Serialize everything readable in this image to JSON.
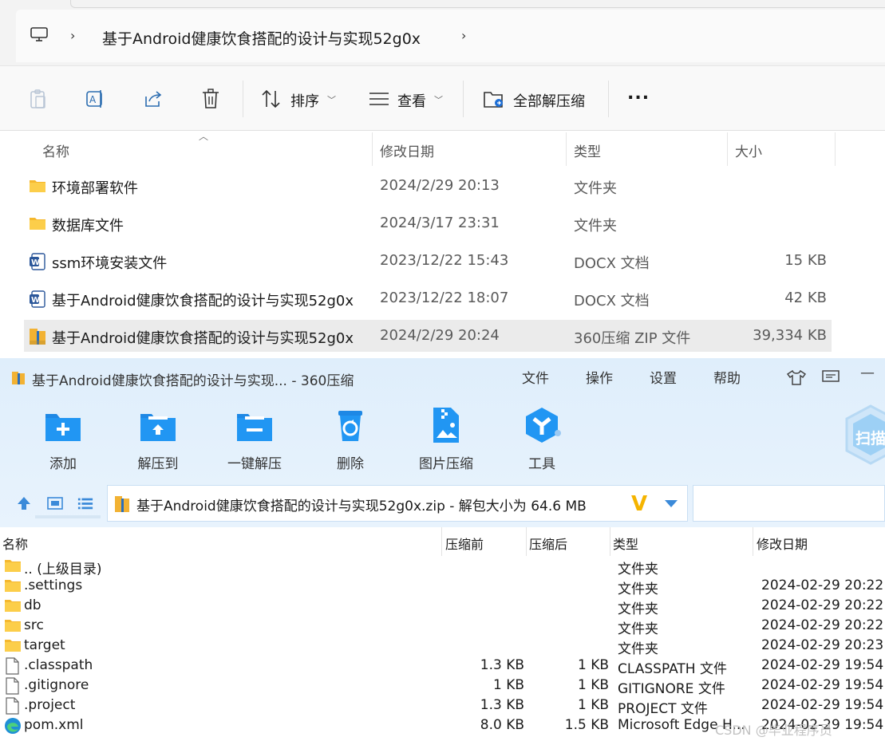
{
  "explorer": {
    "breadcrumb": "基于Android健康饮食搭配的设计与实现52g0x",
    "toolbar": {
      "sort_label": "排序",
      "view_label": "查看",
      "extract_all_label": "全部解压缩",
      "more_label": "..."
    },
    "columns": {
      "name": "名称",
      "date": "修改日期",
      "type": "类型",
      "size": "大小"
    },
    "files": [
      {
        "name": "环境部署软件",
        "date": "2024/2/29 20:13",
        "type": "文件夹",
        "size": "",
        "icon": "folder"
      },
      {
        "name": "数据库文件",
        "date": "2024/3/17 23:31",
        "type": "文件夹",
        "size": "",
        "icon": "folder"
      },
      {
        "name": "ssm环境安装文件",
        "date": "2023/12/22 15:43",
        "type": "DOCX 文档",
        "size": "15 KB",
        "icon": "word"
      },
      {
        "name": "基于Android健康饮食搭配的设计与实现52g0x",
        "date": "2023/12/22 18:07",
        "type": "DOCX 文档",
        "size": "42 KB",
        "icon": "word"
      },
      {
        "name": "基于Android健康饮食搭配的设计与实现52g0x",
        "date": "2024/2/29 20:24",
        "type": "360压缩 ZIP 文件",
        "size": "39,334 KB",
        "icon": "zip",
        "selected": true
      }
    ]
  },
  "zipapp": {
    "title": "基于Android健康饮食搭配的设计与实现... - 360压缩",
    "menu": [
      "文件",
      "操作",
      "设置",
      "帮助"
    ],
    "toolbar": [
      "添加",
      "解压到",
      "一键解压",
      "删除",
      "图片压缩",
      "工具"
    ],
    "scan_badge": "扫描",
    "path": "基于Android健康饮食搭配的设计与实现52g0x.zip - 解包大小为 64.6 MB",
    "columns": {
      "name": "名称",
      "before": "压缩前",
      "after": "压缩后",
      "type": "类型",
      "date": "修改日期"
    },
    "rows": [
      {
        "name": ".. (上级目录)",
        "before": "",
        "after": "",
        "type": "文件夹",
        "date": "",
        "icon": "folder"
      },
      {
        "name": ".settings",
        "before": "",
        "after": "",
        "type": "文件夹",
        "date": "2024-02-29 20:22",
        "icon": "folder"
      },
      {
        "name": "db",
        "before": "",
        "after": "",
        "type": "文件夹",
        "date": "2024-02-29 20:22",
        "icon": "folder"
      },
      {
        "name": "src",
        "before": "",
        "after": "",
        "type": "文件夹",
        "date": "2024-02-29 20:22",
        "icon": "folder"
      },
      {
        "name": "target",
        "before": "",
        "after": "",
        "type": "文件夹",
        "date": "2024-02-29 20:23",
        "icon": "folder"
      },
      {
        "name": ".classpath",
        "before": "1.3 KB",
        "after": "1 KB",
        "type": "CLASSPATH 文件",
        "date": "2024-02-29 19:54",
        "icon": "file"
      },
      {
        "name": ".gitignore",
        "before": "1 KB",
        "after": "1 KB",
        "type": "GITIGNORE 文件",
        "date": "2024-02-29 19:54",
        "icon": "file"
      },
      {
        "name": ".project",
        "before": "1.3 KB",
        "after": "1 KB",
        "type": "PROJECT 文件",
        "date": "2024-02-29 19:54",
        "icon": "file"
      },
      {
        "name": "pom.xml",
        "before": "8.0 KB",
        "after": "1.5 KB",
        "type": "Microsoft Edge H...",
        "date": "2024-02-29 19:54",
        "icon": "edge"
      }
    ],
    "watermark": "CSDN @毕业程序员"
  },
  "colors": {
    "accent": "#1e88e5",
    "folder": "#f8c53a",
    "selected_row": "#ebebeb",
    "app_bg": "#dfeefb"
  }
}
